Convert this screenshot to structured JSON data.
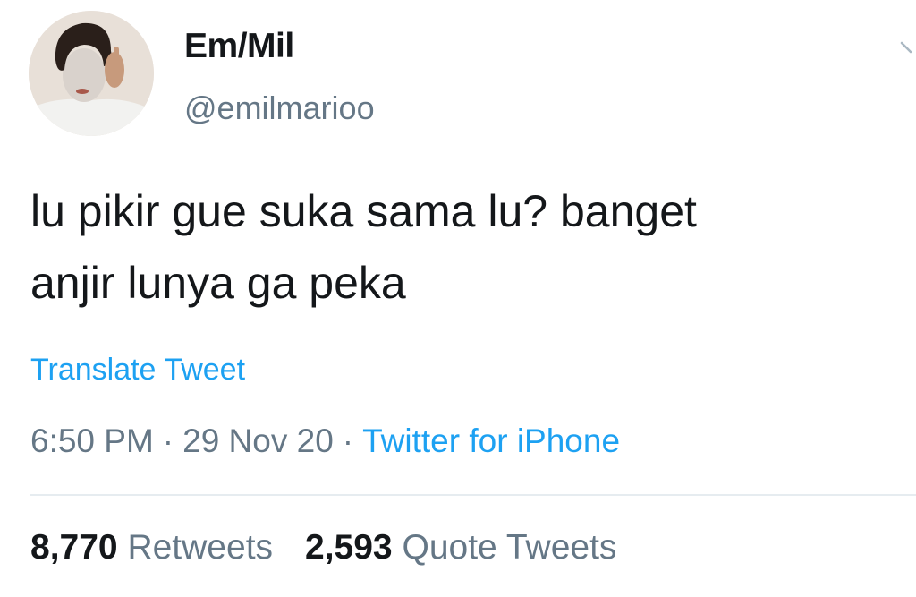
{
  "tweet": {
    "display_name": "Em/Mil",
    "handle": "@emilmarioo",
    "avatar": "profile-photo",
    "text_lines": [
      "lu pikir gue suka sama lu? banget",
      "anjir lunya ga peka"
    ],
    "translate_label": "Translate Tweet",
    "time": "6:50 PM",
    "separator": "·",
    "date": "29 Nov 20",
    "source": "Twitter for iPhone",
    "stats": {
      "retweets_count": "8,770",
      "retweets_label": "Retweets",
      "quotes_count": "2,593",
      "quotes_label": "Quote Tweets"
    }
  },
  "colors": {
    "text": "#14171a",
    "secondary": "#657786",
    "link": "#1da1f2",
    "divider": "#e6ecf0"
  }
}
